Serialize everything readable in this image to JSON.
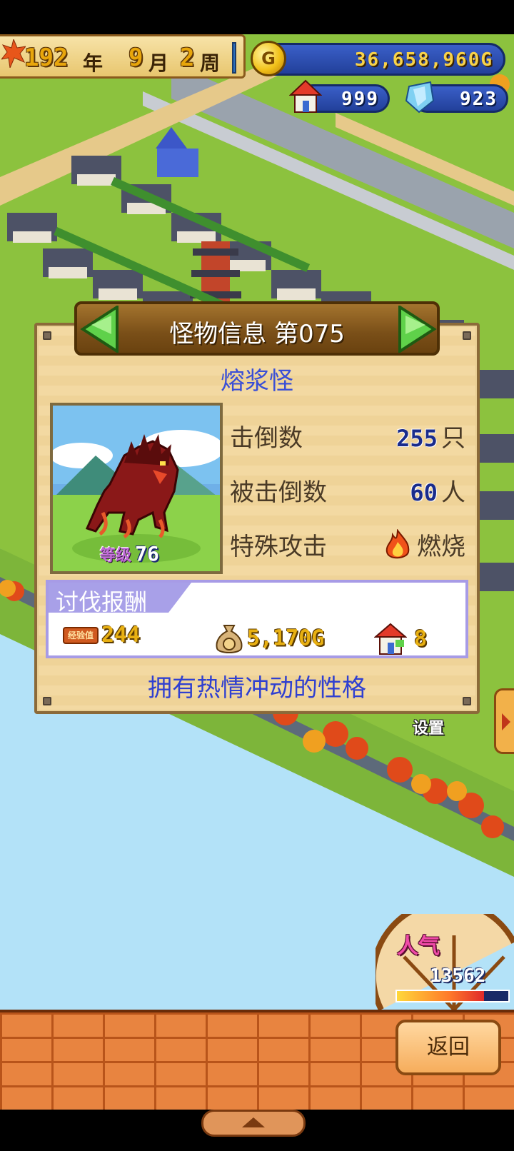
{
  "hud": {
    "year": "192",
    "year_unit": "年",
    "month": "9",
    "month_unit": "月",
    "week": "2",
    "week_unit": "周",
    "gold": "36,658,960G",
    "houses": "999",
    "crystals": "923",
    "coin_symbol": "G"
  },
  "panel": {
    "title": "怪物信息 第075",
    "monster_name": "熔浆怪",
    "level_label": "等级",
    "level": "76",
    "stats": {
      "kills_label": "击倒数",
      "kills_value": "255",
      "kills_unit": "只",
      "defeated_by_label": "被击倒数",
      "defeated_by_value": "60",
      "defeated_by_unit": "人",
      "special_attack_label": "特殊攻击",
      "special_attack_value": "燃烧"
    },
    "reward": {
      "header": "讨伐报酬",
      "exp_tag": "经验值",
      "exp_value": "244",
      "gold_value": "5,170G",
      "house_value": "8"
    },
    "description": "拥有热情冲动的性格"
  },
  "settings_label": "设置",
  "popularity": {
    "label": "人气",
    "value": "13562",
    "fill": 0.78
  },
  "back_button": "返回",
  "colors": {
    "panel_bg": "#f3d9a2",
    "title_bar": "#7a4f18",
    "name_blue": "#3a4fd6",
    "reward_border": "#a79be6",
    "gold_text": "#f7d24a",
    "brick": "#e88440"
  }
}
